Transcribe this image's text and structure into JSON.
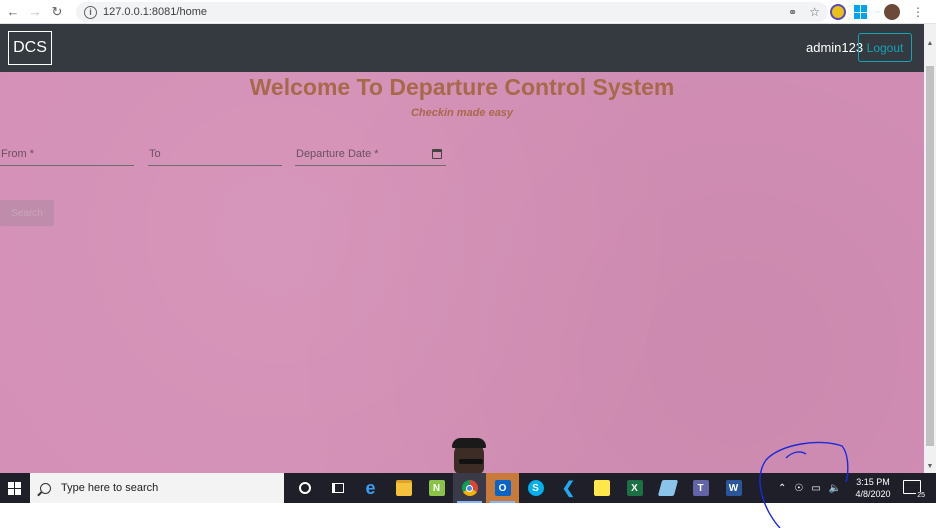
{
  "browser": {
    "url": "127.0.0.1:8081/home",
    "icons": [
      "back-icon",
      "forward-icon",
      "reload-icon",
      "info-icon",
      "key-icon",
      "star-icon",
      "extension-icon",
      "windows-extension-icon",
      "profile-avatar"
    ]
  },
  "navbar": {
    "brand": "DCS",
    "username": "admin123",
    "logout_label": "Logout"
  },
  "page": {
    "title": "Welcome To Departure Control System",
    "subtitle": "Checkin made easy",
    "background_color": "#d48fb6",
    "heading_color": "#a8684a"
  },
  "form": {
    "from_label": "From *",
    "to_label": "To",
    "date_label": "Departure Date *",
    "search_label": "Search"
  },
  "taskbar": {
    "search_placeholder": "Type here to search",
    "apps": [
      "cortana",
      "task-view",
      "edge",
      "file-explorer",
      "notepad-plus",
      "chrome",
      "outlook",
      "skype",
      "vscode",
      "sticky-notes",
      "excel",
      "azure-data-studio",
      "teams",
      "word"
    ],
    "time": "3:15 PM",
    "date": "4/8/2020",
    "notifications": "25"
  }
}
